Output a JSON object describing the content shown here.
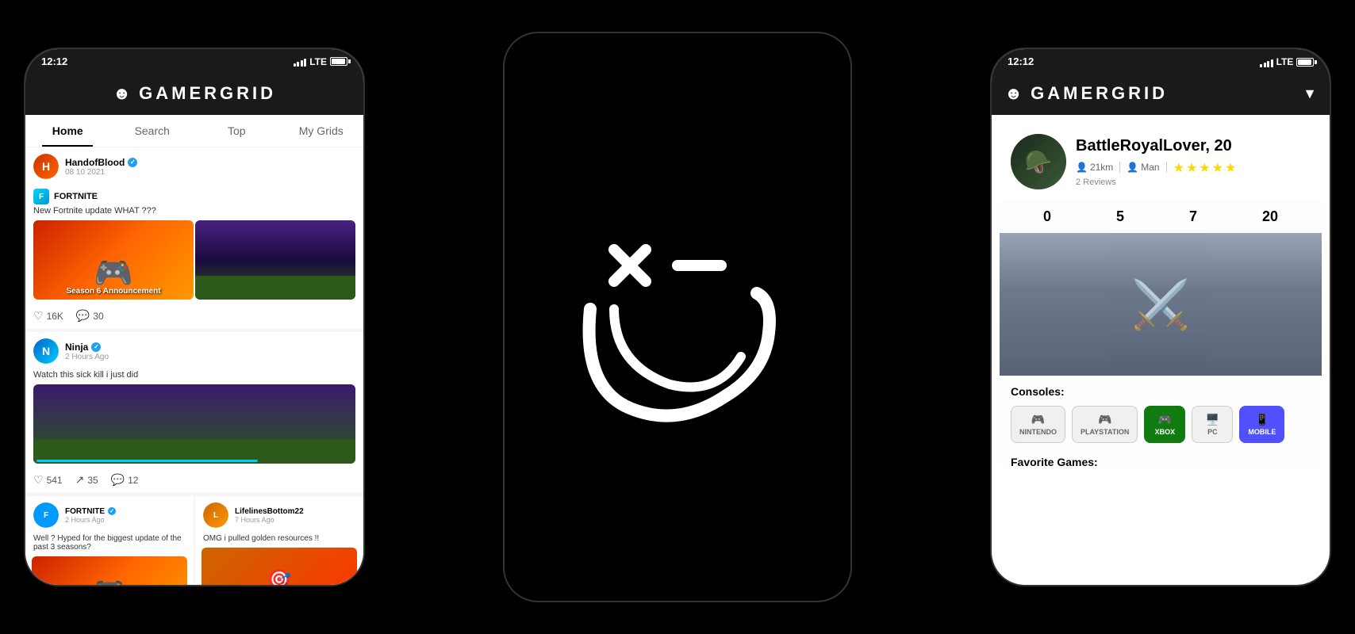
{
  "app": {
    "name": "GAMERGRID",
    "logo_symbol": "☻"
  },
  "phone_left": {
    "status": {
      "time": "12:12",
      "signal": "LTE"
    },
    "nav": {
      "tabs": [
        "Home",
        "Search",
        "Top",
        "My Grids"
      ],
      "active": "Home"
    },
    "posts": [
      {
        "username": "HandofBlood",
        "verified": true,
        "time": "08 10 2021",
        "game_tag": "FORTNITE",
        "text": "New Fortnite update WHAT ???",
        "likes": "16K",
        "comments": "30",
        "has_images": true,
        "image_type": "fortnite_dual"
      },
      {
        "username": "Ninja",
        "verified": true,
        "time": "2 Hours Ago",
        "text": "Watch this sick kill i just did",
        "likes": "541",
        "shares": "35",
        "comments": "12",
        "has_images": true,
        "image_type": "fortnite_single"
      },
      {
        "username": "FORTNITE",
        "verified": true,
        "time": "2 Hours Ago",
        "text": "Well ? Hyped for the biggest update of the past 3 seasons?",
        "has_images": true,
        "image_type": "dual_purple"
      },
      {
        "username": "LifelinesBottom22",
        "time": "7 Hours Ago",
        "text": "OMG i pulled golden resources !!",
        "has_images": true,
        "image_type": "dual_assassin"
      }
    ]
  },
  "phone_center": {
    "logo_visible": true
  },
  "phone_right": {
    "status": {
      "time": "12:12",
      "signal": "LTE"
    },
    "profile": {
      "username": "BattleRoyalLover",
      "age": "20",
      "distance": "21km",
      "gender": "Man",
      "rating": 4.5,
      "reviews": "2 Reviews",
      "stat1": "0",
      "stat2": "5",
      "stat3": "7",
      "stat4": "20"
    },
    "consoles": {
      "label": "Consoles:",
      "items": [
        {
          "name": "NINTENDO",
          "active": false
        },
        {
          "name": "PLAYSTATION",
          "active": false
        },
        {
          "name": "XBOX",
          "active": true,
          "type": "xbox"
        },
        {
          "name": "PC",
          "active": false
        },
        {
          "name": "MOBILE",
          "active": true,
          "type": "mobile"
        }
      ]
    },
    "favorite_games": {
      "label": "Favorite Games:"
    },
    "filter_icon": "▼"
  }
}
